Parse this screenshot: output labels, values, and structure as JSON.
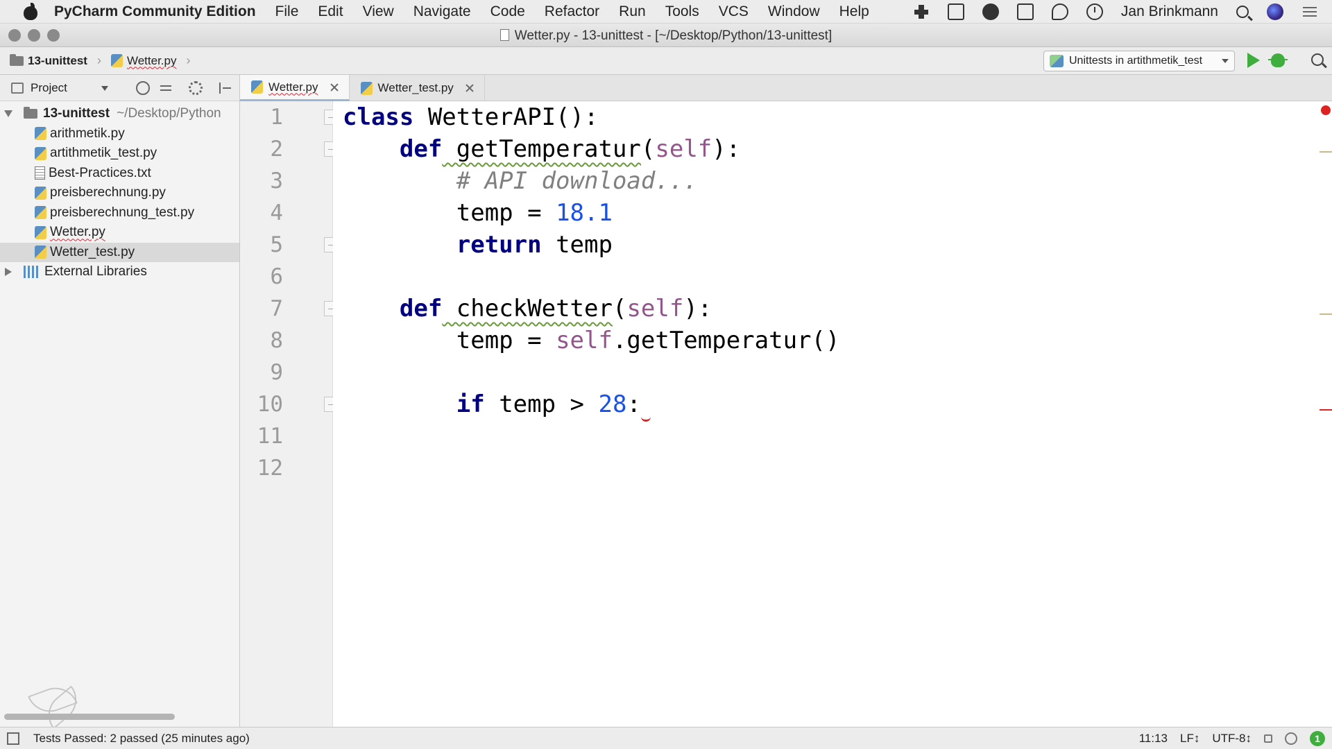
{
  "menubar": {
    "app_name": "PyCharm Community Edition",
    "items": [
      "File",
      "Edit",
      "View",
      "Navigate",
      "Code",
      "Refactor",
      "Run",
      "Tools",
      "VCS",
      "Window",
      "Help"
    ],
    "user": "Jan Brinkmann"
  },
  "window": {
    "title": "Wetter.py - 13-unittest - [~/Desktop/Python/13-unittest]"
  },
  "navbar": {
    "breadcrumb_project": "13-unittest",
    "breadcrumb_file": "Wetter.py",
    "run_config": "Unittests in artithmetik_test"
  },
  "project_panel": {
    "header": "Project",
    "root_name": "13-unittest",
    "root_path": "~/Desktop/Python",
    "files": [
      {
        "name": "arithmetik.py",
        "type": "py"
      },
      {
        "name": "artithmetik_test.py",
        "type": "py"
      },
      {
        "name": "Best-Practices.txt",
        "type": "txt"
      },
      {
        "name": "preisberechnung.py",
        "type": "py"
      },
      {
        "name": "preisberechnung_test.py",
        "type": "py"
      },
      {
        "name": "Wetter.py",
        "type": "py"
      },
      {
        "name": "Wetter_test.py",
        "type": "py"
      }
    ],
    "selected_file": "Wetter_test.py",
    "external": "External Libraries"
  },
  "tabs": [
    {
      "label": "Wetter.py",
      "active": true
    },
    {
      "label": "Wetter_test.py",
      "active": false
    }
  ],
  "editor": {
    "line_numbers": [
      "1",
      "2",
      "3",
      "4",
      "5",
      "6",
      "7",
      "8",
      "9",
      "10",
      "11",
      "12"
    ],
    "code": {
      "l1_kw": "class",
      "l1_rest": " WetterAPI():",
      "l2_kw": "def",
      "l2_name": " getTemperatur",
      "l2_open": "(",
      "l2_self": "self",
      "l2_close": "):",
      "l3_cmt": "# API download...",
      "l4_var": "temp = ",
      "l4_num": "18.1",
      "l5_kw": "return",
      "l5_rest": " temp",
      "l7_kw": "def",
      "l7_name": " checkWetter",
      "l7_open": "(",
      "l7_self": "self",
      "l7_close": "):",
      "l8_var": "temp = ",
      "l8_self": "self",
      "l8_rest": ".getTemperatur()",
      "l10_kw": "if",
      "l10_rest": " temp > ",
      "l10_num": "28",
      "l10_colon": ":"
    },
    "current_line": "11"
  },
  "statusbar": {
    "message": "Tests Passed: 2 passed (25 minutes ago)",
    "position": "11:13",
    "line_sep": "LF↕",
    "encoding": "UTF-8↕",
    "badge": "1"
  }
}
